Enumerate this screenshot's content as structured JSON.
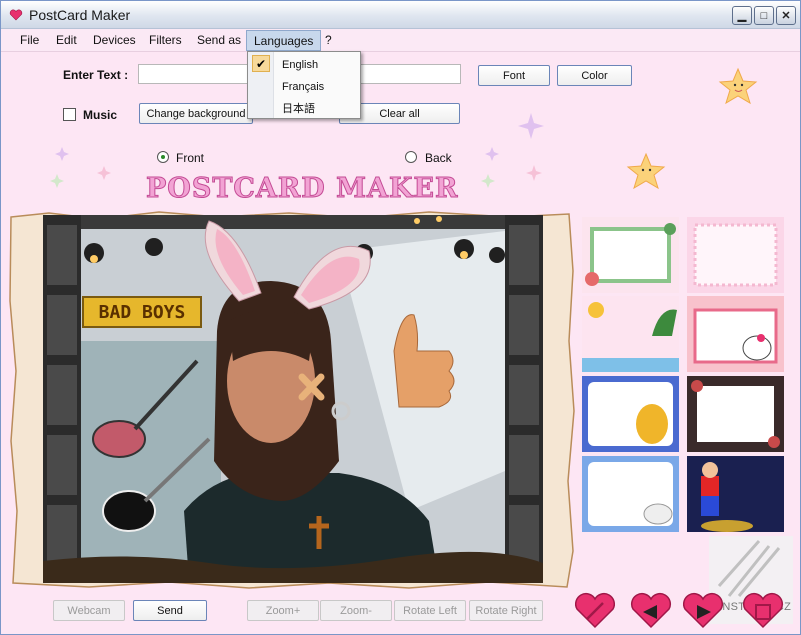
{
  "window": {
    "title": "PostCard Maker"
  },
  "menu": [
    "File",
    "Edit",
    "Devices",
    "Filters",
    "Send as",
    "Languages",
    "?"
  ],
  "languages_menu": {
    "options": [
      "English",
      "Français",
      "日本語"
    ],
    "selected": "English"
  },
  "controls": {
    "enter_text_label": "Enter Text :",
    "enter_text_value": "",
    "font_button": "Font",
    "color_button": "Color",
    "music_label": "Music",
    "music_checked": false,
    "change_background_button": "Change background",
    "clear_all_button": "Clear all",
    "front_label": "Front",
    "back_label": "Back",
    "side_selected": "Front"
  },
  "logo": "POSTCARD MAKER",
  "photo": {
    "sign_text": "BAD BOYS"
  },
  "templates": [
    "flowers-frame",
    "pink-dots-frame",
    "sun-palm-frame",
    "hello-kitty-frame",
    "pooh-frame",
    "dark-floral-frame",
    "sheep-frame",
    "mario-frame"
  ],
  "bottom_buttons": {
    "webcam": "Webcam",
    "send": "Send",
    "zoom_in": "Zoom+",
    "zoom_out": "Zoom-",
    "rotate_left": "Rotate Left",
    "rotate_right": "Rotate Right"
  },
  "watermark": "INSTALUJ.CZ",
  "colors": {
    "background": "#fde6f4",
    "accent": "#e8306e",
    "logo": "#f2a3d4"
  }
}
